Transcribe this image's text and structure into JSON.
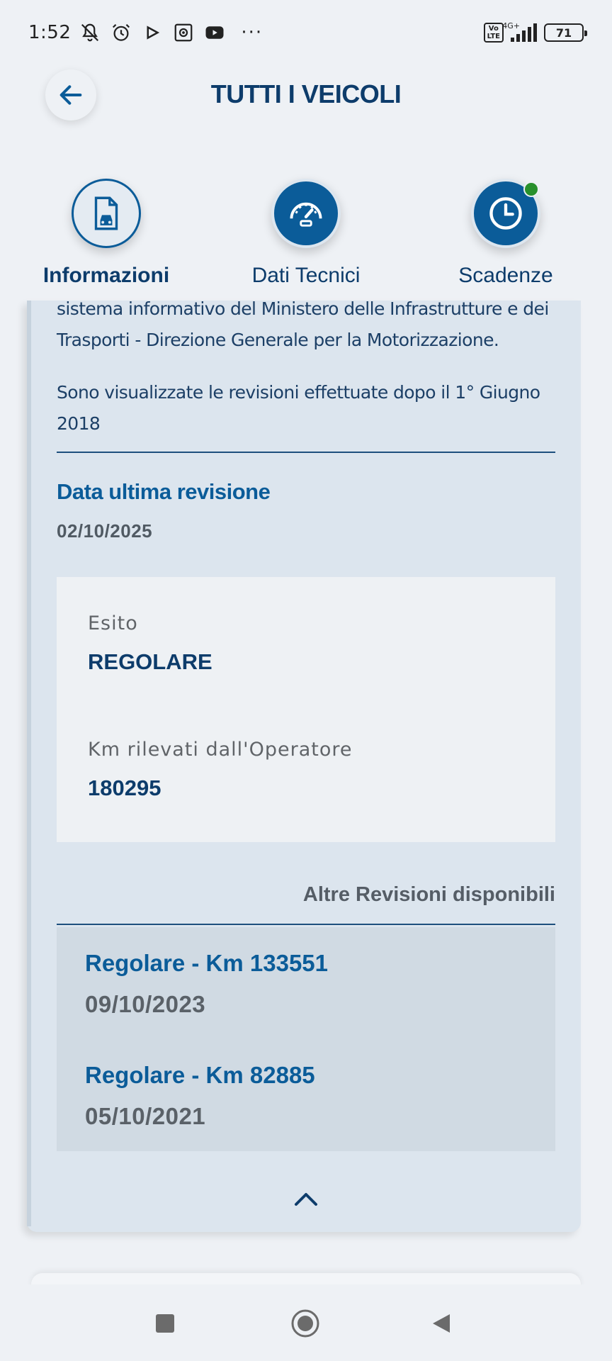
{
  "status_bar": {
    "time": "1:52",
    "dots": "···",
    "volte": "Vo\nLTE",
    "network": "4G+",
    "battery": "71"
  },
  "header": {
    "title": "TUTTI I VEICOLI"
  },
  "tabs": [
    {
      "label": "Informazioni",
      "active": true,
      "icon": "document-car-icon"
    },
    {
      "label": "Dati Tecnici",
      "active": false,
      "icon": "speedometer-icon"
    },
    {
      "label": "Scadenze",
      "active": false,
      "icon": "clock-icon",
      "notification": true
    }
  ],
  "info": {
    "line1": "sistema informativo del Ministero delle Infrastrutture e dei",
    "line2": "Trasporti - Direzione Generale per la Motorizzazione.",
    "line3": "Sono visualizzate le revisioni effettuate dopo il 1° Giugno",
    "line4": "2018"
  },
  "last_revision": {
    "title": "Data ultima revisione",
    "date": "02/10/2025",
    "esito_label": "Esito",
    "esito_value": "REGOLARE",
    "km_label": "Km rilevati dall'Operatore",
    "km_value": "180295"
  },
  "other_revisions": {
    "link_label": "Altre Revisioni disponibili",
    "items": [
      {
        "title": "Regolare - Km 133551",
        "date": "09/10/2023"
      },
      {
        "title": "Regolare - Km 82885",
        "date": "05/10/2021"
      }
    ]
  },
  "colors": {
    "primary": "#0b5c99",
    "dark_text": "#0d3c6b",
    "card_bg": "#dce5ee",
    "notification_dot": "#28902c"
  }
}
